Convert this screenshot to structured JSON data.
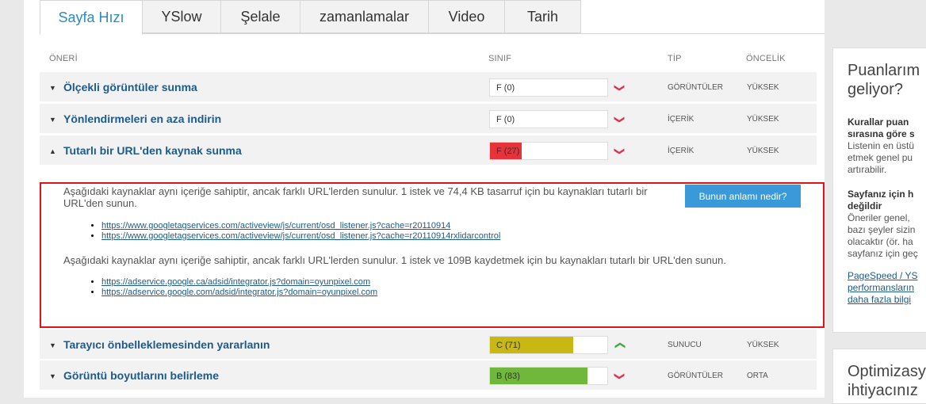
{
  "tabs": [
    {
      "label": "Sayfa Hızı",
      "active": true
    },
    {
      "label": "YSlow"
    },
    {
      "label": "Şelale"
    },
    {
      "label": "zamanlamalar"
    },
    {
      "label": "Video"
    },
    {
      "label": "Tarih"
    }
  ],
  "table": {
    "headers": {
      "recommendation": "ÖNERİ",
      "grade": "SINIF",
      "type": "TİP",
      "priority": "ÖNCELİK"
    },
    "rows": [
      {
        "title": "Ölçekli görüntüler sunma",
        "grade": "F (0)",
        "score": 0,
        "color": "#ffffff",
        "trend": "down",
        "type": "GÖRÜNTÜLER",
        "priority": "YÜKSEK"
      },
      {
        "title": "Yönlendirmeleri en aza indirin",
        "grade": "F (0)",
        "score": 0,
        "color": "#ffffff",
        "trend": "down",
        "type": "İÇERİK",
        "priority": "YÜKSEK"
      },
      {
        "title": "Tutarlı bir URL'den kaynak sunma",
        "grade": "F (27)",
        "score": 27,
        "color": "#e8323a",
        "trend": "down",
        "type": "İÇERİK",
        "priority": "YÜKSEK"
      },
      {
        "title": "Tarayıcı önbelleklemesinden yararlanın",
        "grade": "C (71)",
        "score": 71,
        "color": "#c9b814",
        "trend": "up",
        "type": "SUNUCU",
        "priority": "YÜKSEK"
      },
      {
        "title": "Görüntü boyutlarını belirleme",
        "grade": "B (83)",
        "score": 83,
        "color": "#6fb83b",
        "trend": "down",
        "type": "GÖRÜNTÜLER",
        "priority": "ORTA"
      }
    ]
  },
  "detail": {
    "button": "Bunun anlamı nedir?",
    "para1": "Aşağıdaki kaynaklar aynı içeriğe sahiptir, ancak farklı URL'lerden sunulur. 1 istek ve 74,4 KB tasarruf için bu kaynakları tutarlı bir URL'den sunun.",
    "links1": [
      "https://www.googletagservices.com/activeview/js/current/osd_listener.js?cache=r20110914",
      "https://www.googletagservices.com/activeview/js/current/osd_listener.js?cache=r20110914rxlidarcontrol"
    ],
    "para2": "Aşağıdaki kaynaklar aynı içeriğe sahiptir, ancak farklı URL'lerden sunulur. 1 istek ve 109B kaydetmek için bu kaynakları tutarlı bir URL'den sunun.",
    "links2": [
      "https://adservice.google.ca/adsid/integrator.js?domain=oyunpixel.com",
      "https://adservice.google.com/adsid/integrator.js?domain=oyunpixel.com"
    ]
  },
  "sidebar": {
    "box1": {
      "title1": "Puanlarım",
      "title2": "geliyor?",
      "bold1": "Kurallar puan",
      "bold2": "sırasına göre s",
      "text1": "Listenin en üstü",
      "text2": "etmek genel pu",
      "text3": "artırabilir.",
      "bold3": "Sayfanız için h",
      "bold4": "değildir",
      "text4": "Öneriler genel, ",
      "text5": "bazı şeyler sizin",
      "text6": "olacaktır (ör. ha",
      "text7": "sayfanız için geç",
      "link1": "PageSpeed / YS",
      "link2": "performansların",
      "link3": "daha fazla bilgi"
    },
    "box2": {
      "title1": "Optimizasy",
      "title2": "ihtiyacınız"
    }
  }
}
